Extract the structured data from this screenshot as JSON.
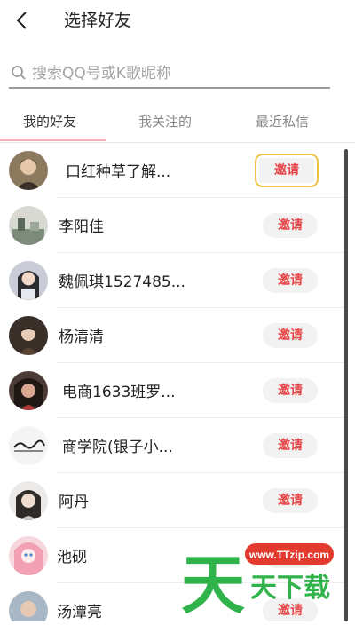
{
  "header": {
    "title": "选择好友"
  },
  "search": {
    "placeholder": "搜索QQ号或K歌昵称"
  },
  "tabs": [
    {
      "label": "我的好友"
    },
    {
      "label": "我关注的"
    },
    {
      "label": "最近私信"
    }
  ],
  "friends": [
    {
      "name": "口红种草了解...",
      "invite": "邀请"
    },
    {
      "name": "李阳佳",
      "invite": "邀请"
    },
    {
      "name": "魏佩琪1527485...",
      "invite": "邀请"
    },
    {
      "name": "杨清清",
      "invite": "邀请"
    },
    {
      "name": "电商1633班罗...",
      "invite": "邀请"
    },
    {
      "name": "商学院(银子小...",
      "invite": "邀请"
    },
    {
      "name": "阿丹",
      "invite": "邀请"
    },
    {
      "name": "池砚",
      "invite": "邀请"
    },
    {
      "name": "汤潭亮",
      "invite": "邀请"
    }
  ],
  "watermark": {
    "url": "www.TTzip.com",
    "text": "天下载",
    "brand_glyph": "天"
  },
  "colors": {
    "accent": "#e8474a",
    "focus": "#f0c348",
    "watermark_green": "#2fb34a",
    "watermark_red": "#e23b2e"
  }
}
